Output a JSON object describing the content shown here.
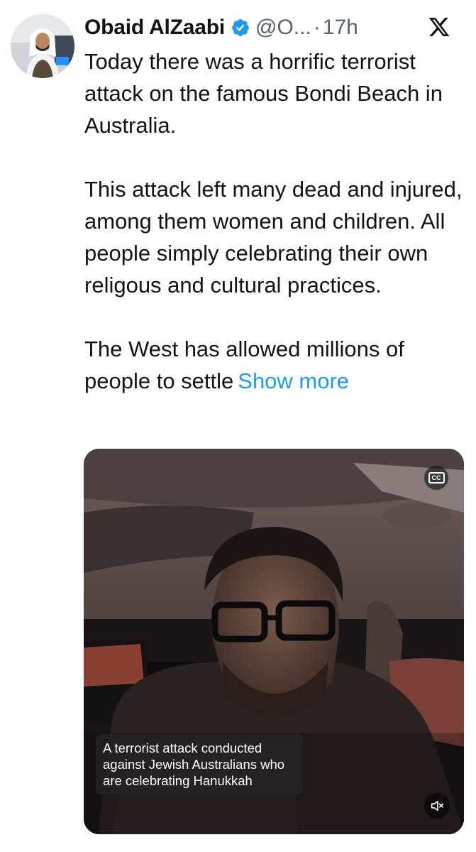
{
  "post": {
    "author_name": "Obaid AlZaabi",
    "handle": "@O...",
    "separator": "·",
    "time": "17h",
    "paragraphs": [
      "Today there was a horrific terrorist attack on the famous Bondi Beach in Australia.",
      "This attack left many dead and injured, among them women and children. All people simply celebrating their own religous and cultural practices.",
      "The West has allowed millions of people to settle"
    ],
    "show_more": "Show more"
  },
  "media": {
    "cc_label": "CC",
    "caption": "A terrorist attack conducted against Jewish Australians who are celebrating Hanukkah"
  },
  "icons": {
    "verified": "verified-badge-icon",
    "platform": "x-logo-icon",
    "captions": "closed-captions-icon",
    "mute": "muted-speaker-icon"
  },
  "colors": {
    "link": "#1d9bf0",
    "verified": "#1d9bf0",
    "secondary_text": "#536471",
    "primary_text": "#0f1419"
  }
}
